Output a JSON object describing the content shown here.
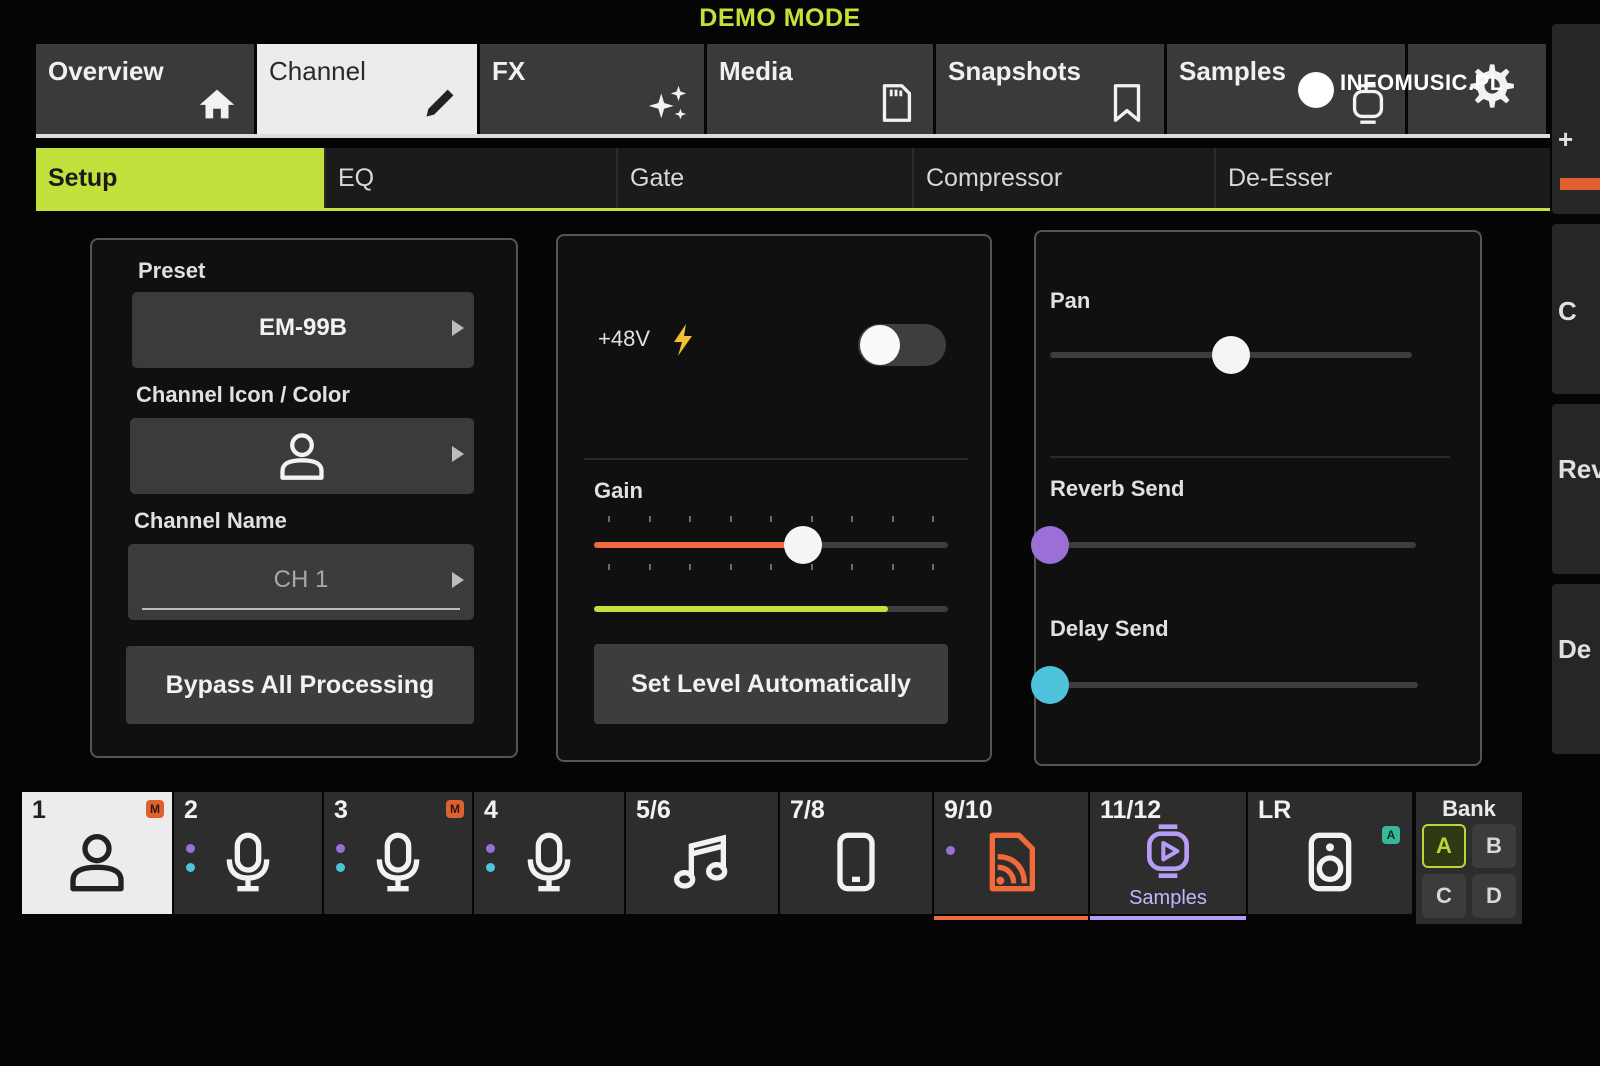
{
  "header": {
    "mode_label": "DEMO MODE"
  },
  "top_tabs": [
    {
      "label": "Overview",
      "icon": "home-icon",
      "active": false
    },
    {
      "label": "Channel",
      "icon": "pencil-icon",
      "active": true
    },
    {
      "label": "FX",
      "icon": "sparkle-icon",
      "active": false
    },
    {
      "label": "Media",
      "icon": "sd-card-icon",
      "active": false
    },
    {
      "label": "Snapshots",
      "icon": "bookmark-icon",
      "active": false
    },
    {
      "label": "Samples",
      "icon": "samples-icon",
      "active": false
    },
    {
      "label": "",
      "icon": "gear-icon",
      "active": false
    }
  ],
  "sub_tabs": [
    {
      "label": "Setup",
      "active": true
    },
    {
      "label": "EQ",
      "active": false
    },
    {
      "label": "Gate",
      "active": false
    },
    {
      "label": "Compressor",
      "active": false
    },
    {
      "label": "De-Esser",
      "active": false
    }
  ],
  "setup": {
    "preset_label": "Preset",
    "preset_value": "EM-99B",
    "icon_color_label": "Channel Icon / Color",
    "channel_icon": "person-icon",
    "channel_name_label": "Channel Name",
    "channel_name_placeholder": "CH 1",
    "bypass_button": "Bypass All Processing"
  },
  "input": {
    "phantom_label": "+48V",
    "phantom_on": false,
    "gain_label": "Gain",
    "gain_fraction": 0.59,
    "meter_fraction": 0.83,
    "set_level_button": "Set Level Automatically"
  },
  "sends": {
    "pan_label": "Pan",
    "pan_fraction": 0.5,
    "reverb_label": "Reverb Send",
    "reverb_fraction": 0.0,
    "delay_label": "Delay Send",
    "delay_fraction": 0.0
  },
  "channels": [
    {
      "num": "1",
      "icon": "person-icon",
      "active": true,
      "badge": "M"
    },
    {
      "num": "2",
      "icon": "microphone-icon",
      "active": false,
      "badge": ""
    },
    {
      "num": "3",
      "icon": "microphone-icon",
      "active": false,
      "badge": "M"
    },
    {
      "num": "4",
      "icon": "microphone-icon",
      "active": false,
      "badge": ""
    },
    {
      "num": "5/6",
      "icon": "music-note-icon",
      "active": false,
      "badge": ""
    },
    {
      "num": "7/8",
      "icon": "phone-icon",
      "active": false,
      "badge": ""
    },
    {
      "num": "9/10",
      "icon": "stream-icon",
      "active": false,
      "badge": ""
    },
    {
      "num": "11/12",
      "icon": "samples-icon",
      "active": false,
      "badge": "",
      "sub": "Samples"
    },
    {
      "num": "LR",
      "icon": "speaker-icon",
      "active": false,
      "badge": "A"
    }
  ],
  "bank": {
    "label": "Bank",
    "options": [
      "A",
      "B",
      "C",
      "D"
    ],
    "selected": "A"
  },
  "edge": {
    "texts": [
      "+",
      "C",
      "Rev",
      "De"
    ]
  },
  "watermark": {
    "text": "INFOMUSIC.PL"
  },
  "colors": {
    "accent": "#c3e13c",
    "gain": "#f06a3a",
    "reverb": "#9a6fd6",
    "delay": "#4fc3dc",
    "stream": "#f06a3a",
    "samples": "#b79cf5"
  }
}
